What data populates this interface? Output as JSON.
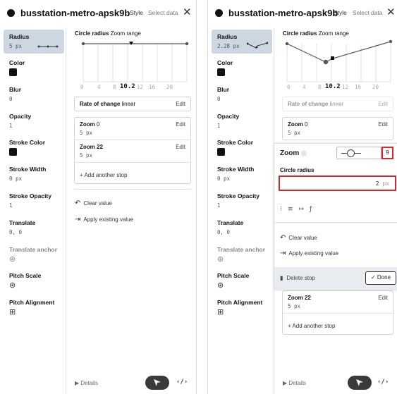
{
  "header": {
    "title": "busstation-metro-apsk9b",
    "tab_style": "Style",
    "tab_select_data": "Select data",
    "close": "✕"
  },
  "sidebar": {
    "items": [
      {
        "label": "Radius",
        "value_left": "5 px",
        "value_right": "2.28 px"
      },
      {
        "label": "Color"
      },
      {
        "label": "Blur",
        "value": "0"
      },
      {
        "label": "Opacity",
        "value": "1"
      },
      {
        "label": "Stroke Color"
      },
      {
        "label": "Stroke Width",
        "value": "0 px"
      },
      {
        "label": "Stroke Opacity",
        "value": "1"
      },
      {
        "label": "Translate",
        "value": "0, 0"
      },
      {
        "label": "Translate anchor"
      },
      {
        "label": "Pitch Scale"
      },
      {
        "label": "Pitch Alignment"
      }
    ]
  },
  "editor": {
    "label_main": "Circle radius",
    "label_sub": "Zoom range",
    "axis_ticks": [
      "0",
      "4",
      "8",
      "12",
      "16",
      "20"
    ],
    "current_zoom": "10.2",
    "rate_label": "Rate of change",
    "rate_value": "linear",
    "edit": "Edit",
    "stops": [
      {
        "zoom_label": "Zoom",
        "zoom": "0",
        "value": "5 px"
      },
      {
        "zoom_label": "Zoom",
        "zoom": "22",
        "value": "5 px"
      }
    ],
    "add_stop": "+ Add another stop",
    "clear_value": "Clear value",
    "apply_existing": "Apply existing value"
  },
  "popup": {
    "title": "Zoom",
    "zoom_value": "9",
    "field_label": "Circle radius",
    "field_value": "2",
    "field_unit": "px",
    "clear_value": "Clear value",
    "apply_existing": "Apply existing value",
    "delete_stop": "Delete stop",
    "done": "Done"
  },
  "footer": {
    "details": "▶ Details",
    "code": "‹/›"
  },
  "colors": {
    "selected_bg": "#cdd7e2",
    "highlight_red": "#d9262c",
    "swatch": "#111111"
  }
}
